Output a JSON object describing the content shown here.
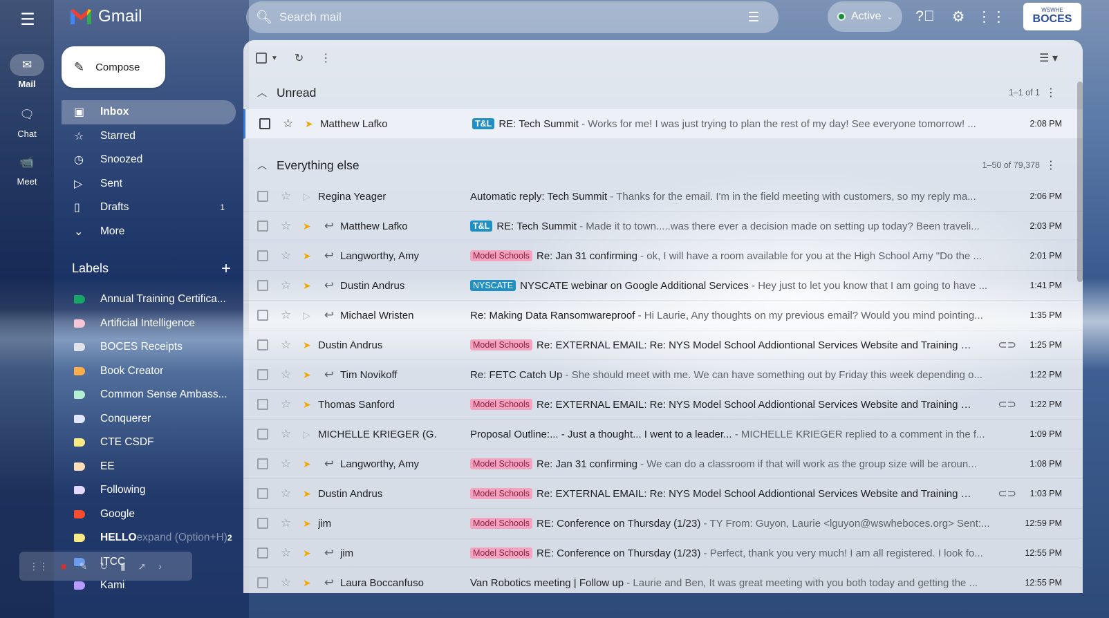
{
  "app": {
    "name": "Gmail",
    "search_placeholder": "Search mail",
    "status": "Active",
    "account_small": "WSWHE",
    "account_big": "BOCES"
  },
  "rail": [
    {
      "label": "Mail",
      "icon": "mail-icon",
      "glyph": "✉",
      "active": true
    },
    {
      "label": "Chat",
      "icon": "chat-icon",
      "glyph": "🗨",
      "active": false
    },
    {
      "label": "Meet",
      "icon": "video-icon",
      "glyph": "📹",
      "active": false
    }
  ],
  "compose_label": "Compose",
  "nav": [
    {
      "label": "Inbox",
      "glyph": "▣",
      "count": "",
      "active": true
    },
    {
      "label": "Starred",
      "glyph": "☆",
      "count": ""
    },
    {
      "label": "Snoozed",
      "glyph": "◷",
      "count": ""
    },
    {
      "label": "Sent",
      "glyph": "▷",
      "count": ""
    },
    {
      "label": "Drafts",
      "glyph": "▯",
      "count": "1"
    },
    {
      "label": "More",
      "glyph": "⌄",
      "count": ""
    }
  ],
  "labels_title": "Labels",
  "labels": [
    {
      "label": "Annual Training Certifica...",
      "color": "#16a765",
      "count": ""
    },
    {
      "label": "Artificial Intelligence",
      "color": "#f6c5d6",
      "count": ""
    },
    {
      "label": "BOCES Receipts",
      "color": "#e0e4ea",
      "count": ""
    },
    {
      "label": "Book Creator",
      "color": "#ffad47",
      "count": ""
    },
    {
      "label": "Common Sense Ambass...",
      "color": "#b3efd3",
      "count": ""
    },
    {
      "label": "Conquerer",
      "color": "#e0e6ff",
      "count": ""
    },
    {
      "label": "CTE CSDF",
      "color": "#fbe983",
      "count": ""
    },
    {
      "label": "EE",
      "color": "#ffdeb5",
      "count": ""
    },
    {
      "label": "Following",
      "color": "#e3d7ff",
      "count": ""
    },
    {
      "label": "Google",
      "color": "#fb4c2f",
      "count": ""
    },
    {
      "label": "HELLO",
      "color": "#fbe983",
      "count": "2",
      "bold": true,
      "hint": "expand (Option+H)"
    },
    {
      "label": "ITCC",
      "color": "#4a86e8",
      "count": ""
    },
    {
      "label": "Kami",
      "color": "#b99aff",
      "count": ""
    }
  ],
  "sections": {
    "unread": {
      "title": "Unread",
      "range": "1–1 of 1"
    },
    "else": {
      "title": "Everything else",
      "range": "1–50 of 79,378"
    }
  },
  "unread_rows": [
    {
      "sender": "Matthew Lafko",
      "badge": "T&L",
      "badge_type": "tl",
      "subject": "RE: Tech Summit",
      "snippet": " - Works for me! I was just trying to plan the rest of my day! See everyone tomorrow! ...",
      "time": "2:08 PM",
      "replied": false,
      "important": true,
      "attach": false
    }
  ],
  "rows": [
    {
      "sender": "Regina Yeager",
      "badge": "",
      "badge_type": "",
      "subject": "Automatic reply: Tech Summit",
      "snippet": " - Thanks for the email. I'm in the field meeting with customers, so my reply ma...",
      "time": "2:06 PM",
      "replied": false,
      "important": false,
      "attach": false
    },
    {
      "sender": "Matthew Lafko",
      "badge": "T&L",
      "badge_type": "tl",
      "subject": "RE: Tech Summit",
      "snippet": " - Made it to town.....was there ever a decision made on setting up today? Been traveli...",
      "time": "2:03 PM",
      "replied": true,
      "important": true,
      "attach": false
    },
    {
      "sender": "Langworthy, Amy",
      "badge": "Model Schools",
      "badge_type": "ms",
      "subject": "Re: Jan 31 confirming",
      "snippet": " - ok, I will have a room available for you at the High School Amy \"Do the ...",
      "time": "2:01 PM",
      "replied": true,
      "important": true,
      "attach": false
    },
    {
      "sender": "Dustin Andrus",
      "badge": "NYSCATE",
      "badge_type": "ny",
      "subject": "NYSCATE webinar on Google Additional Services",
      "snippet": " - Hey just to let you know that I am going to have ...",
      "time": "1:41 PM",
      "replied": true,
      "important": true,
      "attach": false
    },
    {
      "sender": "Michael Wristen",
      "badge": "",
      "badge_type": "",
      "subject": "Re: Making Data Ransomwareproof",
      "snippet": " - Hi Laurie, Any thoughts on my previous email? Would you mind pointing...",
      "time": "1:35 PM",
      "replied": true,
      "important": false,
      "attach": false
    },
    {
      "sender": "Dustin Andrus",
      "badge": "Model Schools",
      "badge_type": "ms",
      "subject": "Re: EXTERNAL EMAIL: Re: NYS Model School Addiontional Services Website and Training Mate...",
      "snippet": "",
      "time": "1:25 PM",
      "replied": false,
      "important": true,
      "attach": true
    },
    {
      "sender": "Tim Novikoff",
      "badge": "",
      "badge_type": "",
      "subject": "Re: FETC Catch Up",
      "snippet": " - She should meet with me. We can have something out by Friday this week depending o...",
      "time": "1:22 PM",
      "replied": true,
      "important": true,
      "attach": false
    },
    {
      "sender": "Thomas Sanford",
      "badge": "Model Schools",
      "badge_type": "ms",
      "subject": "Re: EXTERNAL EMAIL: Re: NYS Model School Addiontional Services Website and Training Mate...",
      "snippet": "",
      "time": "1:22 PM",
      "replied": false,
      "important": true,
      "attach": true
    },
    {
      "sender": "MICHELLE KRIEGER (G.",
      "badge": "",
      "badge_type": "",
      "subject": "Proposal Outline:... - Just a thought... I went to a leader...",
      "snippet": " - MICHELLE KRIEGER replied to a comment in the f...",
      "time": "1:09 PM",
      "replied": false,
      "important": false,
      "attach": false
    },
    {
      "sender": "Langworthy, Amy",
      "badge": "Model Schools",
      "badge_type": "ms",
      "subject": "Re: Jan 31 confirming",
      "snippet": " - We can do a classroom if that will work as the group size will be aroun...",
      "time": "1:08 PM",
      "replied": true,
      "important": true,
      "attach": false
    },
    {
      "sender": "Dustin Andrus",
      "badge": "Model Schools",
      "badge_type": "ms",
      "subject": "Re: EXTERNAL EMAIL: Re: NYS Model School Addiontional Services Website and Training Mate...",
      "snippet": "",
      "time": "1:03 PM",
      "replied": false,
      "important": true,
      "attach": true
    },
    {
      "sender": "jim",
      "badge": "Model Schools",
      "badge_type": "ms",
      "subject": "RE: Conference on Thursday (1/23)",
      "snippet": " - TY From: Guyon, Laurie <lguyon@wswheboces.org> Sent:...",
      "time": "12:59 PM",
      "replied": false,
      "important": true,
      "attach": false
    },
    {
      "sender": "jim",
      "badge": "Model Schools",
      "badge_type": "ms",
      "subject": "RE: Conference on Thursday (1/23)",
      "snippet": " - Perfect, thank you very much! I am all registered. I look fo...",
      "time": "12:55 PM",
      "replied": true,
      "important": true,
      "attach": false
    },
    {
      "sender": "Laura Boccanfuso",
      "badge": "",
      "badge_type": "",
      "subject": "Van Robotics meeting | Follow up",
      "snippet": " - Laurie and Ben, It was great meeting with you both today and getting the ...",
      "time": "12:55 PM",
      "replied": true,
      "important": true,
      "attach": false
    }
  ]
}
